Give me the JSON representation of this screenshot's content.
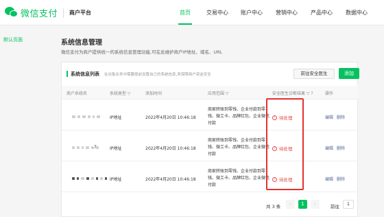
{
  "header": {
    "logo_text": "微信支付",
    "subtitle": "商户平台",
    "nav": [
      {
        "label": "首页",
        "active": true
      },
      {
        "label": "交易中心",
        "active": false
      },
      {
        "label": "账户中心",
        "active": false
      },
      {
        "label": "营销中心",
        "active": false
      },
      {
        "label": "产品中心",
        "active": false
      },
      {
        "label": "数据中心",
        "active": false
      }
    ]
  },
  "sidebar": {
    "items": [
      {
        "label": "默认页面"
      }
    ]
  },
  "main": {
    "title": "系统信息管理",
    "description": "微信支付为商户提供统一的系统信息管理功能,可在此维护商户IP地址、域名、URL",
    "card": {
      "title": "系统信息列表",
      "tip": "在出售业务中需要提前设置自己的系统信息,来保障商户资金安全",
      "check_button": "前往安全医生",
      "add_button": "添加"
    },
    "table": {
      "headers": {
        "merchant": "商户系统名",
        "type": "系统类型 ▽",
        "time": "添加时间",
        "scope": "应用范围 ▽",
        "result": "安全医生诊断结果 ▽ ?",
        "ops": "操作"
      },
      "rows": [
        {
          "merchant_suffix": "",
          "type": "IP地址",
          "time": "2022年4月20日 10:46:18",
          "scope": "商家转账到零钱、企业付款到零钱、微工卡、品牌红包、企业微信付款",
          "status": "待处理",
          "edit": "编辑",
          "delete": "删除"
        },
        {
          "merchant_suffix": "7",
          "type": "IP地址",
          "time": "2022年4月20日 10:46:18",
          "scope": "商家转账到零钱、企业付款到零钱、微工卡、品牌红包、企业微信付款",
          "status": "待处理",
          "edit": "编辑",
          "delete": "删除"
        },
        {
          "merchant_suffix": "",
          "type": "IP地址",
          "time": "2022年4月20日 10:46:18",
          "scope": "商家转账到零钱、企业付款到零钱、微工卡、品牌红包、企业微信付款",
          "status": "待处理",
          "edit": "编辑",
          "delete": "删除"
        }
      ]
    },
    "pagination": {
      "total": "共 3 条",
      "current": "1",
      "goto_label": "前往",
      "goto_value": "1",
      "prev_icon": "‹",
      "next_icon": "›"
    }
  },
  "colors": {
    "brand": "#07c160",
    "warning": "#e34d4d",
    "link": "#576b95",
    "highlight": "#e5302e"
  }
}
